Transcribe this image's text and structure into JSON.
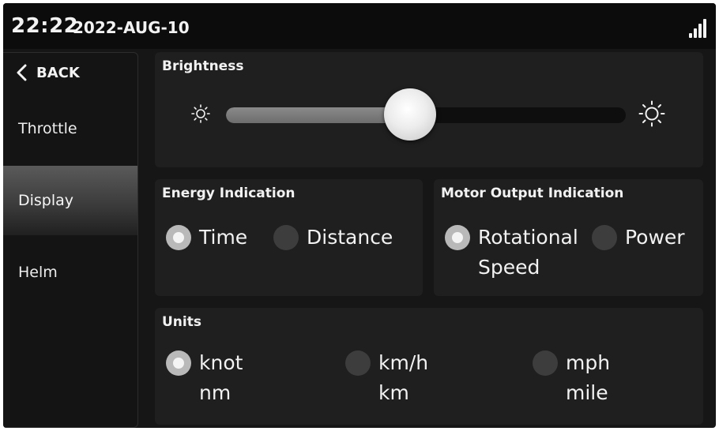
{
  "status": {
    "time": "22:22",
    "date": "2022-AUG-10"
  },
  "sidebar": {
    "back_label": "BACK",
    "items": [
      {
        "label": "Throttle"
      },
      {
        "label": "Display"
      },
      {
        "label": "Helm"
      }
    ],
    "active_item": "Display"
  },
  "brightness": {
    "title": "Brightness",
    "level_fraction": 0.46
  },
  "energy": {
    "title": "Energy Indication",
    "options": [
      {
        "label": "Time"
      },
      {
        "label": "Distance"
      }
    ],
    "selected": "Time"
  },
  "motor": {
    "title": "Motor Output Indication",
    "options": [
      {
        "label": "Rotational",
        "label2": "Speed"
      },
      {
        "label": "Power"
      }
    ],
    "selected": "Rotational Speed"
  },
  "units": {
    "title": "Units",
    "options": [
      {
        "label": "knot",
        "label2": "nm"
      },
      {
        "label": "km/h",
        "label2": "km"
      },
      {
        "label": "mph",
        "label2": "mile"
      }
    ],
    "selected": "knot"
  },
  "colors": {
    "background": "#161616",
    "panel": "#1f1f1f",
    "active_nav": "#4a4a4a",
    "radio_selected": "#b9b9b9",
    "radio_unselected": "#3d3d3d"
  },
  "icons": {
    "signal": "signal-strength-icon",
    "back": "chevron-left-icon",
    "brightness_low": "sun-small-icon",
    "brightness_high": "sun-large-icon"
  }
}
